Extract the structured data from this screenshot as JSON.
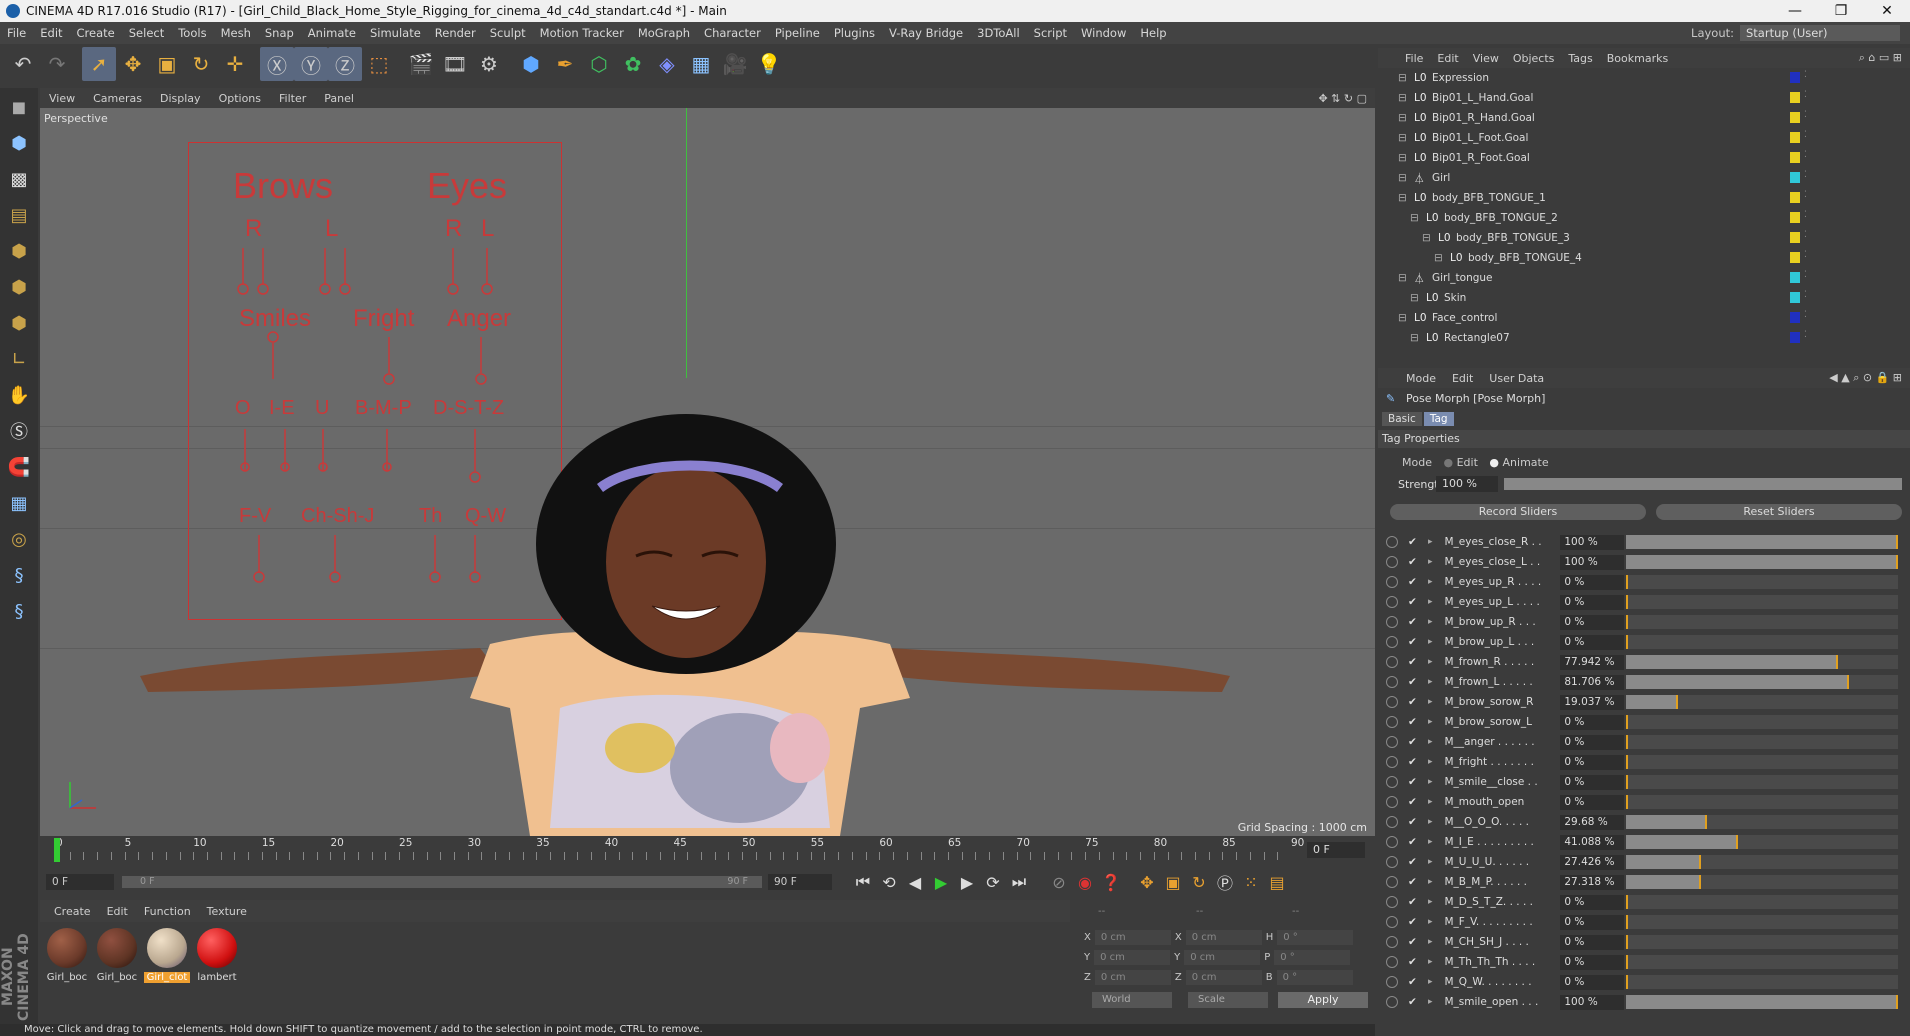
{
  "title": "CINEMA 4D R17.016 Studio (R17) - [Girl_Child_Black_Home_Style_Rigging_for_cinema_4d_c4d_standart.c4d *] - Main",
  "window_controls": [
    "—",
    "❐",
    "✕"
  ],
  "menu": [
    "File",
    "Edit",
    "Create",
    "Select",
    "Tools",
    "Mesh",
    "Snap",
    "Animate",
    "Simulate",
    "Render",
    "Sculpt",
    "Motion Tracker",
    "MoGraph",
    "Character",
    "Pipeline",
    "Plugins",
    "V-Ray Bridge",
    "3DToAll",
    "Script",
    "Window",
    "Help"
  ],
  "layout": {
    "label": "Layout:",
    "value": "Startup (User)"
  },
  "viewport": {
    "menu": [
      "View",
      "Cameras",
      "Display",
      "Options",
      "Filter",
      "Panel"
    ],
    "label": "Perspective",
    "grid_spacing": "Grid Spacing : 1000 cm"
  },
  "face_panel": {
    "brows": "Brows",
    "eyes": "Eyes",
    "r1": "R",
    "l1": "L",
    "r2": "R",
    "l2": "L",
    "smiles": "Smiles",
    "fright": "Fright",
    "anger": "Anger",
    "o": "O",
    "ie": "I-E",
    "u": "U",
    "bmp": "B-M-P",
    "dstz": "D-S-T-Z",
    "fv": "F-V",
    "chshj": "Ch-Sh-J",
    "th": "Th",
    "qw": "Q-W"
  },
  "timeline": {
    "ticks": [
      "0",
      "5",
      "10",
      "15",
      "20",
      "25",
      "30",
      "35",
      "40",
      "45",
      "50",
      "55",
      "60",
      "65",
      "70",
      "75",
      "80",
      "85",
      "90"
    ],
    "frame": "0 F"
  },
  "playbar": {
    "start": "0 F",
    "slider_start": "0 F",
    "slider_end": "90 F",
    "end": "90 F"
  },
  "material_manager": {
    "menu": [
      "Create",
      "Edit",
      "Function",
      "Texture"
    ],
    "materials": [
      {
        "name": "Girl_boc",
        "color": "#6b3a2a"
      },
      {
        "name": "Girl_boc",
        "color": "#5e3424"
      },
      {
        "name": "Girl_clot",
        "color": "#b9a78f"
      },
      {
        "name": "lambert",
        "color": "#d01010"
      }
    ]
  },
  "coords": {
    "head": [
      "--",
      "--",
      "--"
    ],
    "x": "0 cm",
    "y": "0 cm",
    "z": "0 cm",
    "px": "0 cm",
    "py": "0 cm",
    "pz": "0 cm",
    "h": "0 °",
    "p": "0 °",
    "b": "0 °",
    "world": "World",
    "scale": "Scale",
    "apply": "Apply"
  },
  "status": "Move: Click and drag to move elements. Hold down SHIFT to quantize movement / add to the selection in point mode, CTRL to remove.",
  "object_manager": {
    "menu": [
      "File",
      "Edit",
      "View",
      "Objects",
      "Tags",
      "Bookmarks"
    ],
    "rows": [
      {
        "name": "Expression",
        "indent": 0,
        "color": "#2030c0"
      },
      {
        "name": "Bip01_L_Hand.Goal",
        "indent": 0,
        "color": "#e8d020"
      },
      {
        "name": "Bip01_R_Hand.Goal",
        "indent": 0,
        "color": "#e8d020"
      },
      {
        "name": "Bip01_L_Foot.Goal",
        "indent": 0,
        "color": "#e8d020"
      },
      {
        "name": "Bip01_R_Foot.Goal",
        "indent": 0,
        "color": "#e8d020"
      },
      {
        "name": "Girl",
        "indent": 0,
        "color": "#30c8d8"
      },
      {
        "name": "body_BFB_TONGUE_1",
        "indent": 0,
        "color": "#e8d020"
      },
      {
        "name": "body_BFB_TONGUE_2",
        "indent": 1,
        "color": "#e8d020"
      },
      {
        "name": "body_BFB_TONGUE_3",
        "indent": 2,
        "color": "#e8d020"
      },
      {
        "name": "body_BFB_TONGUE_4",
        "indent": 3,
        "color": "#e8d020"
      },
      {
        "name": "Girl_tongue",
        "indent": 0,
        "color": "#30c8d8"
      },
      {
        "name": "Skin",
        "indent": 1,
        "color": "#30c8d8"
      },
      {
        "name": "Face_control",
        "indent": 0,
        "color": "#2030c0"
      },
      {
        "name": "Rectangle07",
        "indent": 1,
        "color": "#2030c0"
      }
    ]
  },
  "attribute_manager": {
    "menu": [
      "Mode",
      "Edit",
      "User Data"
    ],
    "title": "Pose Morph [Pose Morph]",
    "tabs": [
      "Basic",
      "Tag"
    ],
    "section": "Tag Properties",
    "mode_label": "Mode",
    "mode_edit": "Edit",
    "mode_animate": "Animate",
    "strength_label": "Strength",
    "strength_value": "100 %",
    "record": "Record Sliders",
    "reset": "Reset Sliders",
    "poses": [
      {
        "name": "M_eyes_close_R . .",
        "value": "100 %",
        "fraction": 1.0
      },
      {
        "name": "M_eyes_close_L . .",
        "value": "100 %",
        "fraction": 1.0
      },
      {
        "name": "M_eyes_up_R . . . .",
        "value": "0 %",
        "fraction": 0
      },
      {
        "name": "M_eyes_up_L . . . .",
        "value": "0 %",
        "fraction": 0
      },
      {
        "name": "M_brow_up_R . . .",
        "value": "0 %",
        "fraction": 0
      },
      {
        "name": "M_brow_up_L . . .",
        "value": "0 %",
        "fraction": 0
      },
      {
        "name": "M_frown_R . . . . .",
        "value": "77.942 %",
        "fraction": 0.77942
      },
      {
        "name": "M_frown_L . . . . .",
        "value": "81.706 %",
        "fraction": 0.81706
      },
      {
        "name": "M_brow_sorow_R",
        "value": "19.037 %",
        "fraction": 0.19037
      },
      {
        "name": "M_brow_sorow_L",
        "value": "0 %",
        "fraction": 0
      },
      {
        "name": "M__anger . . . . . .",
        "value": "0 %",
        "fraction": 0
      },
      {
        "name": "M_fright . . . . . . .",
        "value": "0 %",
        "fraction": 0
      },
      {
        "name": "M_smile__close . .",
        "value": "0 %",
        "fraction": 0
      },
      {
        "name": "M_mouth_open",
        "value": "0 %",
        "fraction": 0
      },
      {
        "name": "M__O_O_O. . . . .",
        "value": "29.68 %",
        "fraction": 0.2968
      },
      {
        "name": "M_I_E . . . . . . . . .",
        "value": "41.088 %",
        "fraction": 0.41088
      },
      {
        "name": "M_U_U_U. . . . . .",
        "value": "27.426 %",
        "fraction": 0.27426
      },
      {
        "name": "M_B_M_P. . . . . .",
        "value": "27.318 %",
        "fraction": 0.27318
      },
      {
        "name": "M_D_S_T_Z. . . . .",
        "value": "0 %",
        "fraction": 0
      },
      {
        "name": "M_F_V. . . . . . . . .",
        "value": "0 %",
        "fraction": 0
      },
      {
        "name": "M_CH_SH_J . . . .",
        "value": "0 %",
        "fraction": 0
      },
      {
        "name": "M_Th_Th_Th . . . .",
        "value": "0 %",
        "fraction": 0
      },
      {
        "name": "M_Q_W. . . . . . . .",
        "value": "0 %",
        "fraction": 0
      },
      {
        "name": "M_smile_open . . .",
        "value": "100 %",
        "fraction": 1.0
      }
    ]
  },
  "maxon": "MAXON CINEMA 4D"
}
